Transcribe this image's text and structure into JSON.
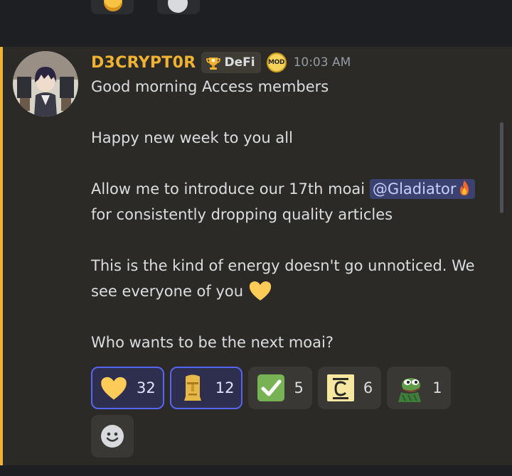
{
  "message": {
    "author": "D3CRYPT0R",
    "role_tag": "DeFi",
    "mod_badge": "MOD",
    "timestamp": "10:03 AM",
    "lines": {
      "l1": "Good morning Access members",
      "l2": "Happy new week to you all",
      "l3_before": "Allow me to introduce our 17th moai ",
      "l3_mention": "@Gladiator",
      "l4": "for consistently dropping quality articles",
      "l5": "This is the kind of energy doesn't go unnoticed. We",
      "l6": "see everyone of you",
      "l7": "Who wants to be the next moai?"
    }
  },
  "reactions": [
    {
      "emoji": "yellow-heart",
      "count": "32",
      "active": true
    },
    {
      "emoji": "moai",
      "count": "12",
      "active": true
    },
    {
      "emoji": "check-mark",
      "count": "5",
      "active": false
    },
    {
      "emoji": "c-box",
      "count": "6",
      "active": false
    },
    {
      "emoji": "pepe-frog",
      "count": "1",
      "active": false
    }
  ],
  "colors": {
    "accent": "#f0b232",
    "mention_bg": "#3c4270",
    "active_reaction_border": "#5865f2"
  }
}
